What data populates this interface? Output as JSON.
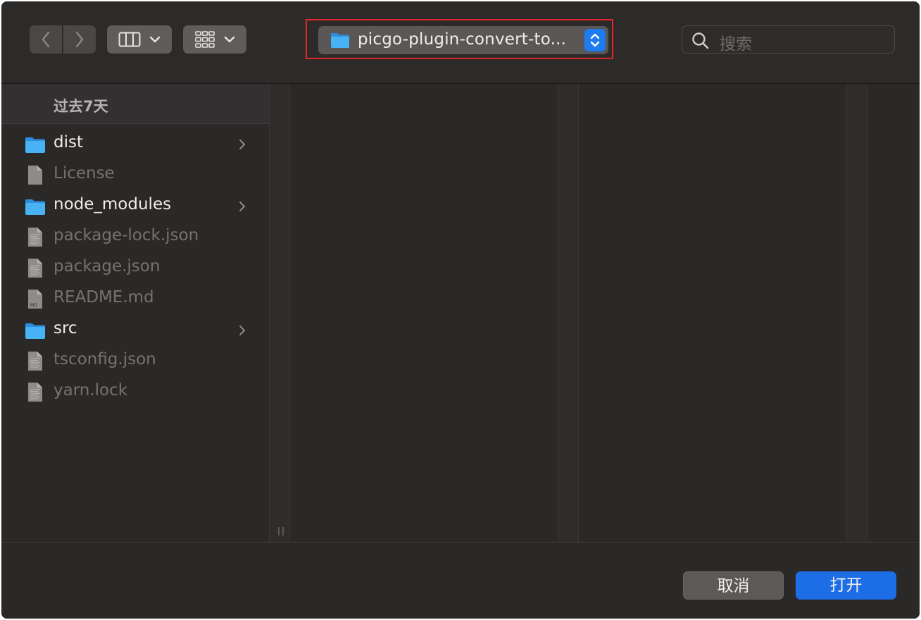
{
  "toolbar": {
    "nav": {
      "back_icon": "chevron-left-icon",
      "forward_icon": "chevron-right-icon"
    },
    "view_mode_icon": "columns-view-icon",
    "group_mode_icon": "grid-group-icon",
    "path": {
      "current": "picgo-plugin-convert-to...",
      "icon": "folder-icon"
    },
    "search": {
      "placeholder": "搜索",
      "icon": "search-icon"
    }
  },
  "browser": {
    "group_title": "过去7天",
    "items": [
      {
        "name": "dist",
        "kind": "folder"
      },
      {
        "name": "License",
        "kind": "file"
      },
      {
        "name": "node_modules",
        "kind": "folder"
      },
      {
        "name": "package-lock.json",
        "kind": "file"
      },
      {
        "name": "package.json",
        "kind": "file"
      },
      {
        "name": "README.md",
        "kind": "file"
      },
      {
        "name": "src",
        "kind": "folder"
      },
      {
        "name": "tsconfig.json",
        "kind": "file"
      },
      {
        "name": "yarn.lock",
        "kind": "file"
      }
    ]
  },
  "footer": {
    "cancel_label": "取消",
    "open_label": "打开"
  },
  "colors": {
    "accent": "#1d6ee6",
    "highlight_box": "#e0262b",
    "folder": "#3aa6f2"
  }
}
